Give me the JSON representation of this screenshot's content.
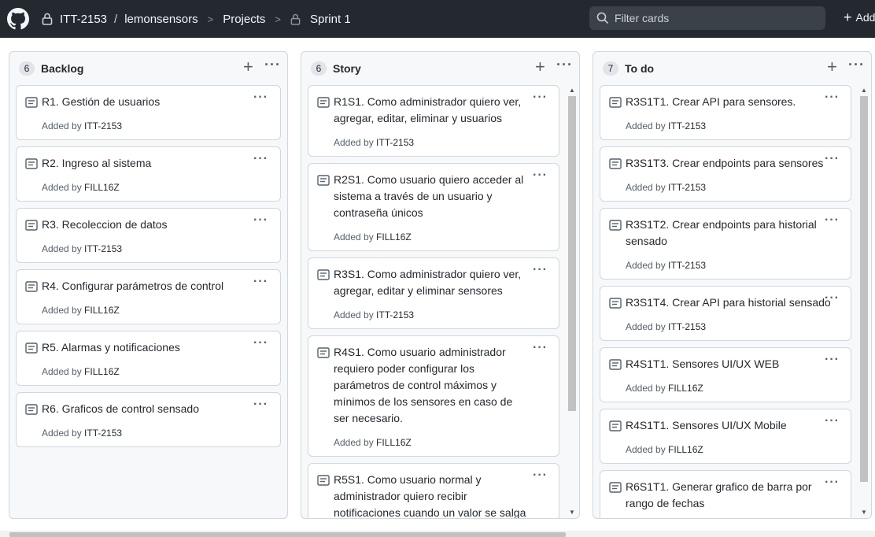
{
  "header": {
    "org": "ITT-2153",
    "repo": "lemonsensors",
    "projects": "Projects",
    "sprint": "Sprint 1",
    "search_placeholder": "Filter cards",
    "add_label": "Add"
  },
  "columns": [
    {
      "count": "6",
      "title": "Backlog",
      "cards": [
        {
          "title": "R1. Gestión de usuarios",
          "added_by": "Added by ",
          "author": "ITT-2153"
        },
        {
          "title": "R2. Ingreso al sistema",
          "added_by": "Added by ",
          "author": "FILL16Z"
        },
        {
          "title": "R3. Recoleccion de datos",
          "added_by": "Added by ",
          "author": "ITT-2153"
        },
        {
          "title": "R4. Configurar parámetros de control",
          "added_by": "Added by ",
          "author": "FILL16Z"
        },
        {
          "title": "R5. Alarmas y notificaciones",
          "added_by": "Added by ",
          "author": "FILL16Z"
        },
        {
          "title": "R6. Graficos de control sensado",
          "added_by": "Added by ",
          "author": "ITT-2153"
        }
      ]
    },
    {
      "count": "6",
      "title": "Story",
      "cards": [
        {
          "title": "R1S1. Como administrador quiero ver, agregar, editar, eliminar y usuarios",
          "added_by": "Added by ",
          "author": "ITT-2153"
        },
        {
          "title": "R2S1. Como usuario quiero acceder al sistema a través de un usuario y contraseña únicos",
          "added_by": "Added by ",
          "author": "FILL16Z"
        },
        {
          "title": "R3S1. Como administrador quiero ver, agregar, editar y eliminar sensores",
          "added_by": "Added by ",
          "author": "ITT-2153"
        },
        {
          "title": "R4S1. Como usuario administrador requiero poder configurar los parámetros de control máximos y mínimos de los sensores en caso de ser necesario.",
          "added_by": "Added by ",
          "author": "FILL16Z"
        },
        {
          "title": "R5S1. Como usuario normal y administrador quiero recibir notificaciones cuando un valor se salga",
          "added_by": "",
          "author": ""
        }
      ]
    },
    {
      "count": "7",
      "title": "To do",
      "cards": [
        {
          "title": "R3S1T1. Crear API para sensores.",
          "added_by": "Added by ",
          "author": "ITT-2153"
        },
        {
          "title": "R3S1T3. Crear endpoints para sensores",
          "added_by": "Added by ",
          "author": "ITT-2153"
        },
        {
          "title": "R3S1T2. Crear endpoints para historial sensado",
          "added_by": "Added by ",
          "author": "ITT-2153"
        },
        {
          "title": "R3S1T4. Crear API para historial sensado",
          "added_by": "Added by ",
          "author": "ITT-2153"
        },
        {
          "title": "R4S1T1. Sensores UI/UX WEB",
          "added_by": "Added by ",
          "author": "FILL16Z"
        },
        {
          "title": "R4S1T1. Sensores UI/UX Mobile",
          "added_by": "Added by ",
          "author": "FILL16Z"
        },
        {
          "title": "R6S1T1. Generar grafico de barra por rango de fechas",
          "added_by": "",
          "author": ""
        }
      ]
    }
  ]
}
